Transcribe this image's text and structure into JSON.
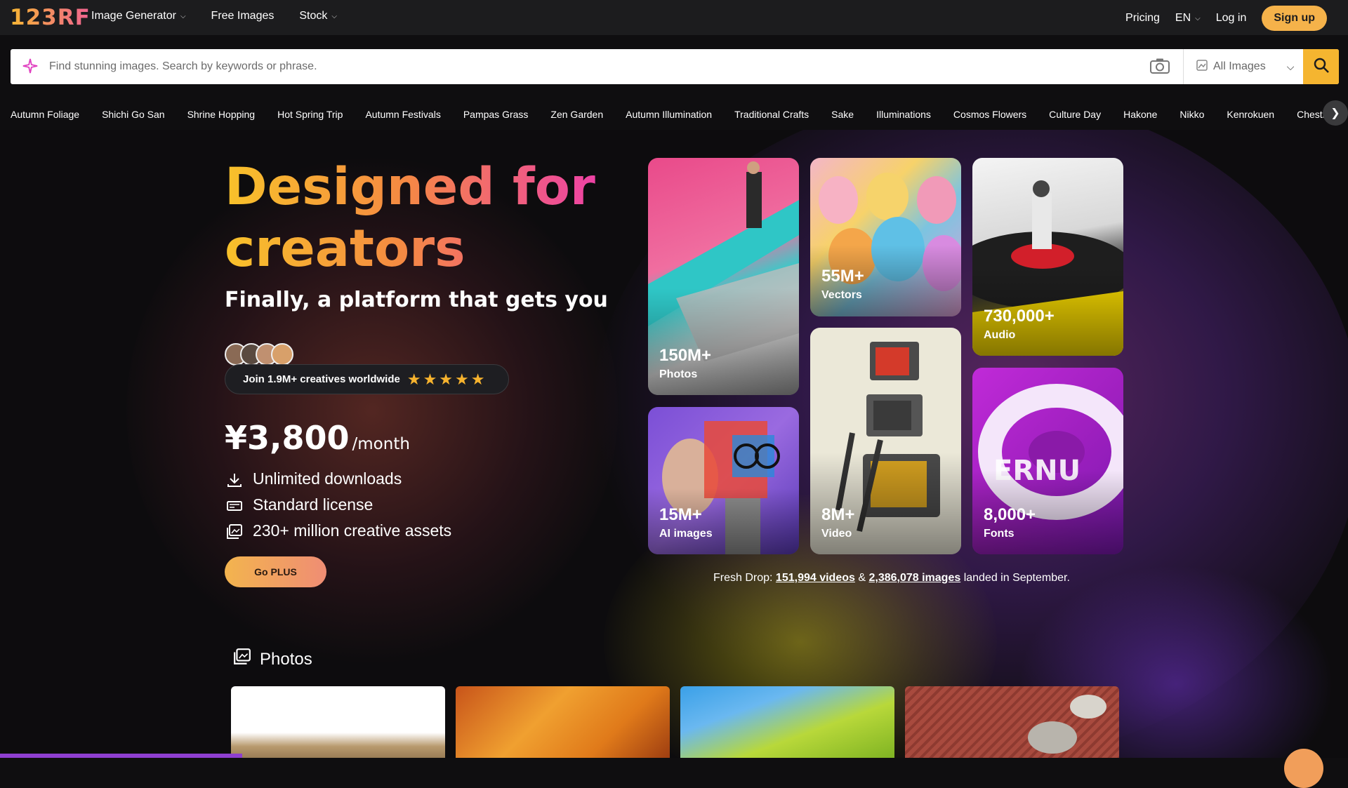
{
  "brand": {
    "logo": "123RF"
  },
  "nav": {
    "left": [
      {
        "label": "Image Generator",
        "dropdown": true
      },
      {
        "label": "Free Images",
        "dropdown": false
      },
      {
        "label": "Stock",
        "dropdown": true
      }
    ],
    "pricing": "Pricing",
    "lang": "EN",
    "login": "Log in",
    "signup": "Sign up"
  },
  "search": {
    "placeholder": "Find stunning images. Search by keywords or phrase.",
    "scope": "All Images"
  },
  "tags": [
    "Autumn Foliage",
    "Shichi Go San",
    "Shrine Hopping",
    "Hot Spring Trip",
    "Autumn Festivals",
    "Pampas Grass",
    "Zen Garden",
    "Autumn Illumination",
    "Traditional Crafts",
    "Sake",
    "Illuminations",
    "Cosmos Flowers",
    "Culture Day",
    "Hakone",
    "Nikko",
    "Kenrokuen",
    "Chestnuts"
  ],
  "hero": {
    "title": "Designed for creators",
    "subtitle": "Finally, a platform that gets you",
    "join": "Join 1.9M+ creatives worldwide",
    "rating": 5,
    "price": "¥3,800",
    "per": "/month",
    "features": [
      "Unlimited downloads",
      "Standard license",
      "230+ million creative assets"
    ],
    "cta": "Go PLUS"
  },
  "cards": [
    {
      "count": "150M+",
      "label": "Photos"
    },
    {
      "count": "55M+",
      "label": "Vectors"
    },
    {
      "count": "730,000+",
      "label": "Audio"
    },
    {
      "count": "15M+",
      "label": "AI images"
    },
    {
      "count": "8M+",
      "label": "Video"
    },
    {
      "count": "8,000+",
      "label": "Fonts"
    }
  ],
  "fresh": {
    "prefix": "Fresh Drop:",
    "videos": "151,994 videos",
    "amp": "&",
    "images": "2,386,078 images",
    "suffix": "landed in September."
  },
  "section": {
    "title": "Photos"
  },
  "colors": {
    "accent": "#f5b530",
    "brand_gradient": [
      "#f8c22a",
      "#ec3ab0"
    ],
    "topbar": "#1c1c1e"
  }
}
